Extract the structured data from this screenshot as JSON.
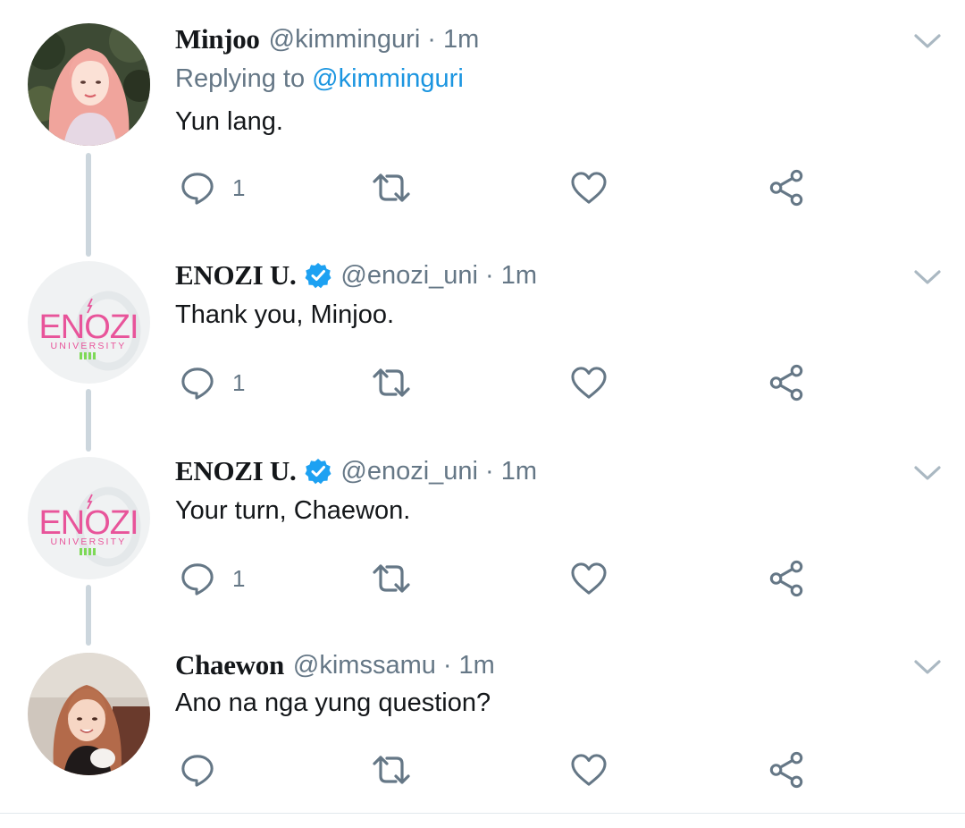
{
  "colors": {
    "text_primary": "#14171a",
    "text_secondary": "#657786",
    "link": "#1b95e0",
    "verified": "#1da1f2",
    "thread_line": "#ccd6dd",
    "icon": "#657786",
    "enozi_pink": "#e8549a",
    "enozi_green": "#7ed957"
  },
  "tweets": [
    {
      "name": "Minjoo",
      "handle": "@kimminguri",
      "separator": "·",
      "time": "1m",
      "verified": false,
      "replying_prefix": "Replying to",
      "replying_to": "@kimminguri",
      "text": "Yun lang.",
      "reply_count": "1",
      "avatar": "minjoo-photo"
    },
    {
      "name": "ENOZI U.",
      "handle": "@enozi_uni",
      "separator": "·",
      "time": "1m",
      "verified": true,
      "text": "Thank you, Minjoo.",
      "reply_count": "1",
      "avatar": "enozi-logo"
    },
    {
      "name": "ENOZI U.",
      "handle": "@enozi_uni",
      "separator": "·",
      "time": "1m",
      "verified": true,
      "text": "Your turn, Chaewon.",
      "reply_count": "1",
      "avatar": "enozi-logo"
    },
    {
      "name": "Chaewon",
      "handle": "@kimssamu",
      "separator": "·",
      "time": "1m",
      "verified": false,
      "text": "Ano na nga yung question?",
      "reply_count": "",
      "avatar": "chaewon-photo"
    }
  ],
  "logo": {
    "wordmark": "ENOZI",
    "subtitle": "UNIVERSITY"
  },
  "icons": {
    "reply": "reply-icon",
    "retweet": "retweet-icon",
    "like": "heart-icon",
    "share": "share-icon",
    "more": "chevron-down-icon",
    "verified": "verified-badge-icon"
  }
}
